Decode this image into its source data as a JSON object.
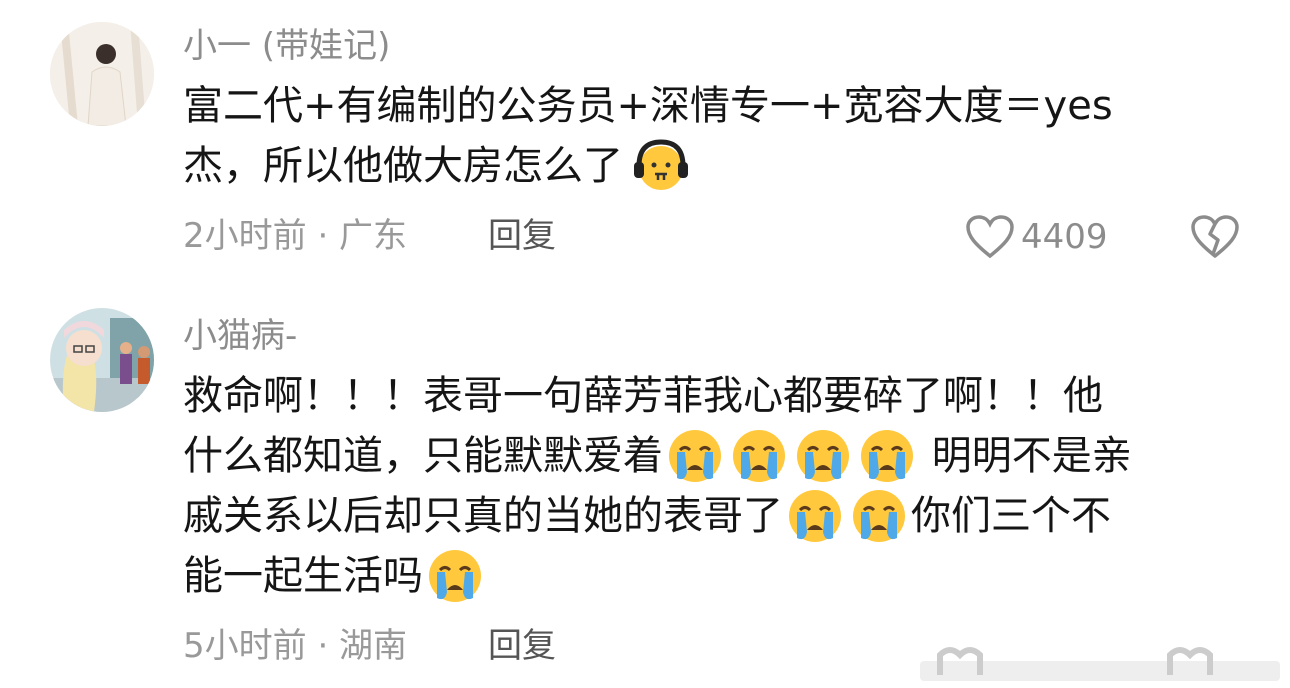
{
  "comments": [
    {
      "username": "小一 (带娃记)",
      "lines": [
        {
          "text": "富二代+有编制的公务员+深情专一+宽容大度＝yes",
          "emojis_after": 0
        },
        {
          "text": "杰，所以他做大房怎么了",
          "emojis_after": 1,
          "emoji": "headphones-face-emoji"
        }
      ],
      "time": "2小时前 · 广东",
      "reply_label": "回复",
      "likes": "4409"
    },
    {
      "username": "小猫病-",
      "lines": [
        {
          "text": "救命啊！！！表哥一句薛芳菲我心都要碎了啊！！他"
        },
        {
          "text": "什么都知道，只能默默爱着",
          "after": "明明不是亲"
        },
        {
          "text": "戚关系以后却只真的当她的表哥了",
          "after": "你们三个不"
        },
        {
          "text": "能一起生活吗"
        }
      ],
      "time": "5小时前 · 湖南",
      "reply_label": "回复"
    }
  ],
  "colors": {
    "username": "#8c8c8c",
    "meta": "#999999",
    "text": "#151515",
    "emoji_yellow": "#FFC83D",
    "tear_blue": "#4FA8E8"
  },
  "icons": [
    "heart-outline-icon",
    "broken-heart-icon",
    "crying-face-emoji",
    "headphones-face-emoji"
  ]
}
